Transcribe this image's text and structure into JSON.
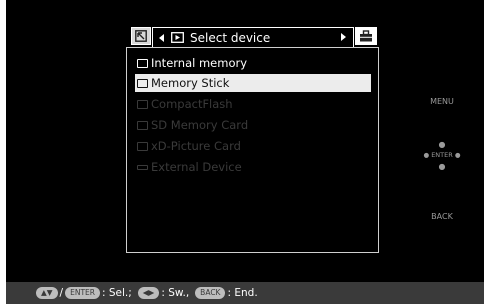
{
  "header": {
    "title": "Select device",
    "left_tab_icon": "return-icon",
    "right_tab_icon": "toolbox-icon"
  },
  "device_list": [
    {
      "label": "Internal memory",
      "state": "enabled",
      "icon": "internal-memory-icon"
    },
    {
      "label": "Memory Stick",
      "state": "selected",
      "icon": "memory-stick-icon"
    },
    {
      "label": "CompactFlash",
      "state": "disabled",
      "icon": "compactflash-icon"
    },
    {
      "label": "SD Memory Card",
      "state": "disabled",
      "icon": "sd-card-icon"
    },
    {
      "label": "xD-Picture Card",
      "state": "disabled",
      "icon": "xd-card-icon"
    },
    {
      "label": "External Device",
      "state": "disabled",
      "icon": "usb-icon"
    }
  ],
  "side_panel": {
    "menu_label": "MENU",
    "enter_label": "ENTER",
    "back_label": "BACK"
  },
  "help_bar": {
    "keys": {
      "enter": "ENTER",
      "back": "BACK"
    },
    "sel_text": ": Sel.;",
    "sw_text": ": Sw.,",
    "end_text": ": End."
  },
  "colors": {
    "background": "#000000",
    "selected_row": "#ececec",
    "disabled_text": "#3a3a3a",
    "help_bar": "#3a3a3a"
  }
}
